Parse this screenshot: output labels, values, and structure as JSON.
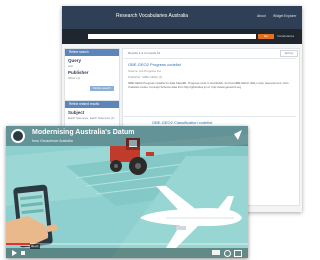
{
  "site": {
    "title": "Research Vocabularies Australia",
    "nav": [
      "About",
      "Widget Explorer"
    ],
    "search_button": "Go",
    "search_option": "Vocabularies",
    "panel_search_header": "Refine search",
    "query_label": "Query",
    "query_value": "test",
    "publisher_label": "Publisher",
    "publisher_value": "Other (1)",
    "refine_button": "Refine search",
    "panel_related_header": "Refine related results",
    "subject_label": "Subject",
    "subject_value": "Earth Sciences, Earth Sciences (1)",
    "results_count": "Results 1-3 of results 61",
    "sort_label": "Sort by",
    "results": [
      {
        "title": "GBE-GEO2 Progress codelist",
        "meta1": "Source: GA Progress list",
        "meta2": "Publisher: GBE-GEO2 (1)",
        "desc": "GBE-GEO2 Progress codelist for data ClassML. Progress code in GeoSciML. Format GBE-GEO2 (1E1) code; Geosciences; GA's Codelists codes; Concept Scheme data from http://gbifcodes.jm.nt; http://www.geosciml.org"
      },
      {
        "title": "GBE-GEO2 Classification codelist"
      }
    ]
  },
  "video": {
    "title": "Modernising Australia's Datum",
    "subtitle": "from Geoscience Australia",
    "timestamp": "00:27",
    "progress_fraction": 0.1
  },
  "colors": {
    "header": "#2f3f55",
    "panel_header": "#5c86b9",
    "search_button": "#e5701f",
    "video_bg": "#8ed0cf",
    "tractor": "#c13b2d",
    "progress": "#e03333"
  }
}
